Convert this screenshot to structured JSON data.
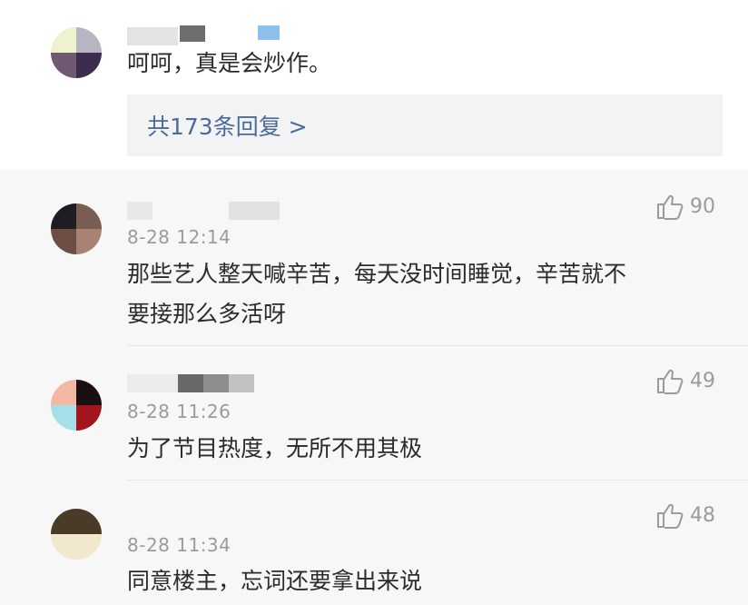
{
  "top_comment": {
    "text": "呵呵，真是会炒作。",
    "reply_link": "共173条回复 >",
    "avatar_colors": [
      "#eef2cf",
      "#b8b5c2",
      "#6f5a72",
      "#3d2c4d"
    ]
  },
  "comments": [
    {
      "time": "8-28 12:14",
      "text_lines": [
        "那些艺人整天喊辛苦，每天没时间睡觉，辛苦就不",
        "要接那么多活呀"
      ],
      "likes": "90",
      "avatar_colors": [
        "#1e1e22",
        "#7a5e54",
        "#6d4e44",
        "#a88272"
      ]
    },
    {
      "time": "8-28 11:26",
      "text_lines": [
        "为了节目热度，无所不用其极"
      ],
      "likes": "49",
      "avatar_colors": [
        "#f3b7a4",
        "#1a0f12",
        "#a7dfe8",
        "#a1151c"
      ]
    },
    {
      "time": "8-28 11:34",
      "text_lines": [
        "同意楼主，忘词还要拿出来说"
      ],
      "likes": "48",
      "avatar_colors": [
        "#4a3a28",
        "#4a3a28",
        "#f2e8cd",
        "#f2e8cd"
      ]
    }
  ],
  "colors": {
    "link": "#4a6b9b",
    "meta": "#9b9b9b",
    "text": "#2b2b2b"
  }
}
